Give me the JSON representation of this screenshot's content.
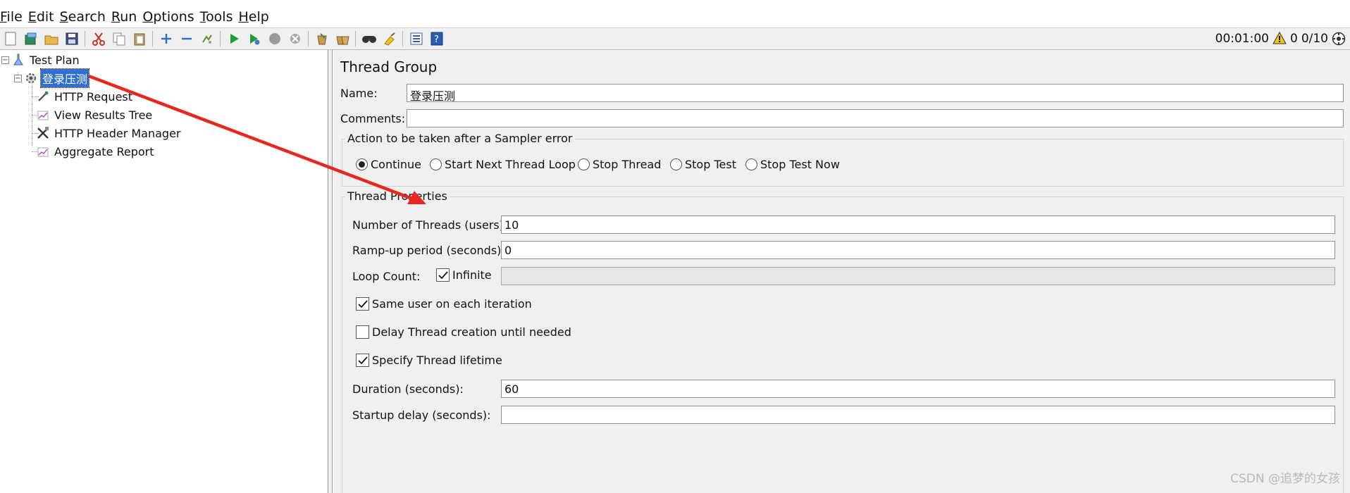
{
  "menu": [
    {
      "mnemonic": "F",
      "rest": "ile"
    },
    {
      "mnemonic": "E",
      "rest": "dit"
    },
    {
      "mnemonic": "S",
      "rest": "earch"
    },
    {
      "mnemonic": "R",
      "rest": "un"
    },
    {
      "mnemonic": "O",
      "rest": "ptions"
    },
    {
      "mnemonic": "T",
      "rest": "ools"
    },
    {
      "mnemonic": "H",
      "rest": "elp"
    }
  ],
  "toolbar_status": {
    "elapsed": "00:01:00",
    "warnings": "0",
    "threads": "0/10"
  },
  "tree": {
    "root": "Test Plan",
    "group": "登录压测",
    "children": [
      "HTTP Request",
      "View Results Tree",
      "HTTP Header Manager",
      "Aggregate Report"
    ]
  },
  "panel": {
    "title": "Thread Group",
    "name_label": "Name:",
    "name_value": "登录压测",
    "comments_label": "Comments:",
    "comments_value": "",
    "sampler_error": {
      "legend": "Action to be taken after a Sampler error",
      "options": [
        "Continue",
        "Start Next Thread Loop",
        "Stop Thread",
        "Stop Test",
        "Stop Test Now"
      ],
      "selected": "Continue"
    },
    "thread_props": {
      "legend": "Thread Properties",
      "threads_label": "Number of Threads (users):",
      "threads_value": "10",
      "rampup_label": "Ramp-up period (seconds):",
      "rampup_value": "0",
      "loop_label": "Loop Count:",
      "infinite_label": "Infinite",
      "same_user_label": "Same user on each iteration",
      "delay_label": "Delay Thread creation until needed",
      "lifetime_label": "Specify Thread lifetime",
      "duration_label": "Duration (seconds):",
      "duration_value": "60",
      "startup_label": "Startup delay (seconds):",
      "startup_value": ""
    }
  },
  "watermark": "CSDN @追梦的女孩",
  "annotation_color": "#e8281e"
}
